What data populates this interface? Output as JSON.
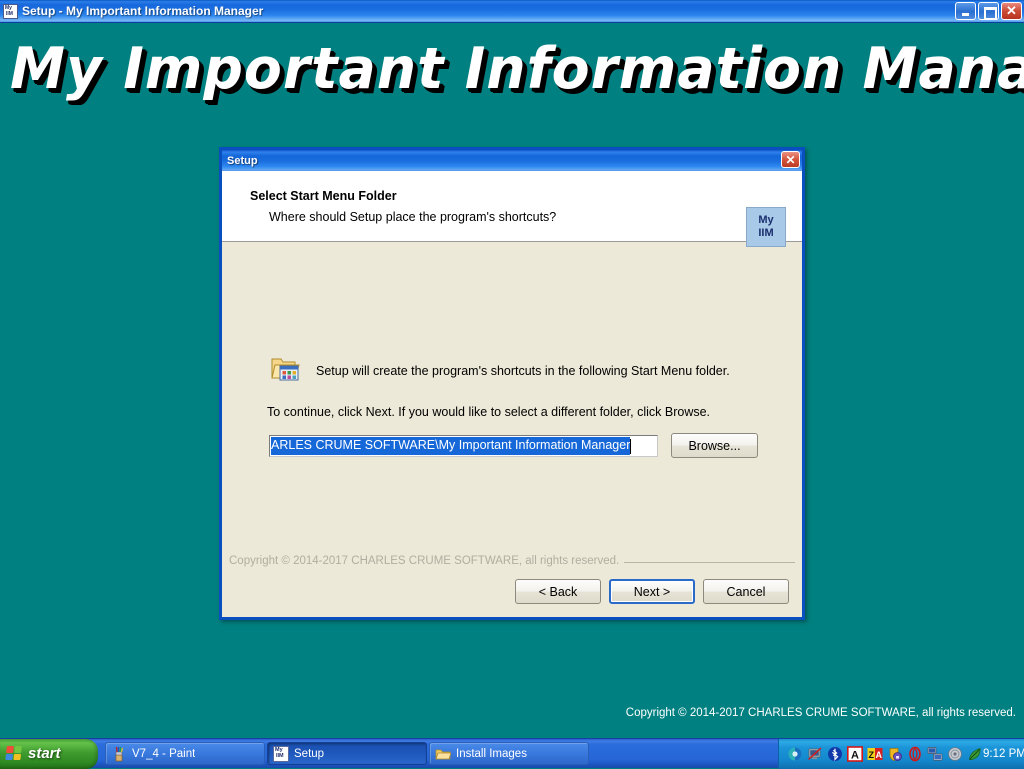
{
  "window": {
    "title": "Setup - My Important Information Manager",
    "icon": "my-iim-icon",
    "controls": {
      "minimize": "minimize-icon",
      "maximize": "restore-icon",
      "close": "close-icon",
      "close_glyph": "✕"
    }
  },
  "desktop": {
    "background_color": "#008080",
    "banner_text": "My Important Information Manager",
    "copyright": "Copyright © 2014-2017 CHARLES CRUME SOFTWARE, all rights reserved."
  },
  "dialog": {
    "title": "Setup",
    "close_glyph": "✕",
    "header": {
      "title": "Select Start Menu Folder",
      "subtitle": "Where should Setup place the program's shortcuts?",
      "icon_line1": "My",
      "icon_line2": "IIM"
    },
    "body": {
      "folder_icon": "folder-program-group-icon",
      "line1": "Setup will create the program's shortcuts in the following Start Menu folder.",
      "line2": "To continue, click Next. If you would like to select a different folder, click Browse.",
      "input_value": "ARLES CRUME SOFTWARE\\My Important Information Manager",
      "input_full_value": "C:\\Users\\...\\CHARLES CRUME SOFTWARE\\My Important Information Manager",
      "browse_label": "Browse..."
    },
    "footer": {
      "copyright": "Copyright © 2014-2017 CHARLES CRUME SOFTWARE, all rights reserved.",
      "back_label": "< Back",
      "next_label": "Next >",
      "cancel_label": "Cancel"
    }
  },
  "taskbar": {
    "start_label": "start",
    "tasks": [
      {
        "label": "V7_4 - Paint",
        "icon": "paint-icon",
        "active": false
      },
      {
        "label": "Setup",
        "icon": "my-iim-icon",
        "active": true
      },
      {
        "label": "Install Images",
        "icon": "folder-icon",
        "active": false
      }
    ],
    "tray": {
      "icons": [
        "gem-icon",
        "network-disconnected-icon",
        "bluetooth-icon",
        "avg-antivirus-icon",
        "zonealarm-icon",
        "security-shield-icon",
        "opera-icon",
        "network-computers-icon",
        "disc-icon",
        "leaf-icon"
      ],
      "clock": "9:12 PM"
    }
  },
  "colors": {
    "desktop_teal": "#008080",
    "dialog_face": "#ece9d8",
    "titlebar_blue": "#1668dc",
    "selection_blue": "#1668d8",
    "accent_close_red": "#cc4b35"
  }
}
